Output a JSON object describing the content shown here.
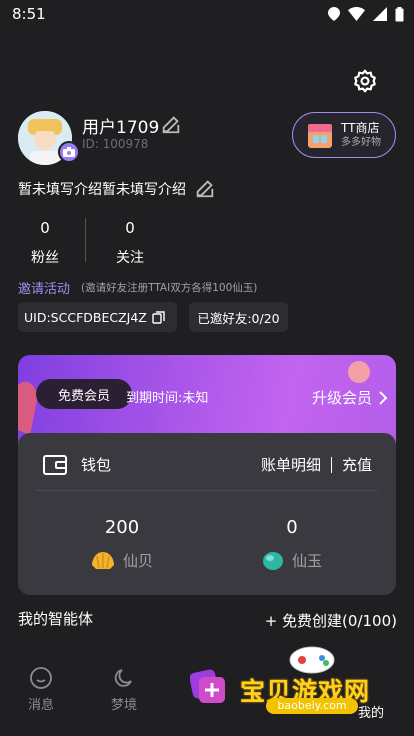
{
  "status_bar": {
    "time": "8:51"
  },
  "profile": {
    "username": "用户1709",
    "user_id": "ID: 100978",
    "bio": "暂未填写介绍暂未填写介绍"
  },
  "shop": {
    "title": "TT商店",
    "subtitle": "多多好物"
  },
  "stats": [
    {
      "value": "0",
      "label": "粉丝"
    },
    {
      "value": "0",
      "label": "关注"
    }
  ],
  "invite": {
    "label": "邀请活动",
    "description": "(邀请好友注册TTAI双方各得100仙玉)",
    "uid": "UID:SCCFDBECZJ4Z",
    "invited": "已邀好友:0/20"
  },
  "vip": {
    "badge": "免费会员",
    "expire": "到期时间:未知",
    "upgrade": "升级会员"
  },
  "wallet": {
    "title": "钱包",
    "bill": "账单明细",
    "recharge": "充值",
    "balances": [
      {
        "value": "200",
        "label": "仙贝"
      },
      {
        "value": "0",
        "label": "仙玉"
      }
    ]
  },
  "agents": {
    "title": "我的智能体",
    "create": "+ 免费创建(0/100)"
  },
  "nav": {
    "messages": "消息",
    "dream": "梦境",
    "mine": "我的"
  },
  "watermark": {
    "text": "宝贝游戏网",
    "url": "baobeiy.com"
  },
  "colors": {
    "accent": "#a58bf2",
    "background": "#1f1f22",
    "card": "#39393f"
  }
}
